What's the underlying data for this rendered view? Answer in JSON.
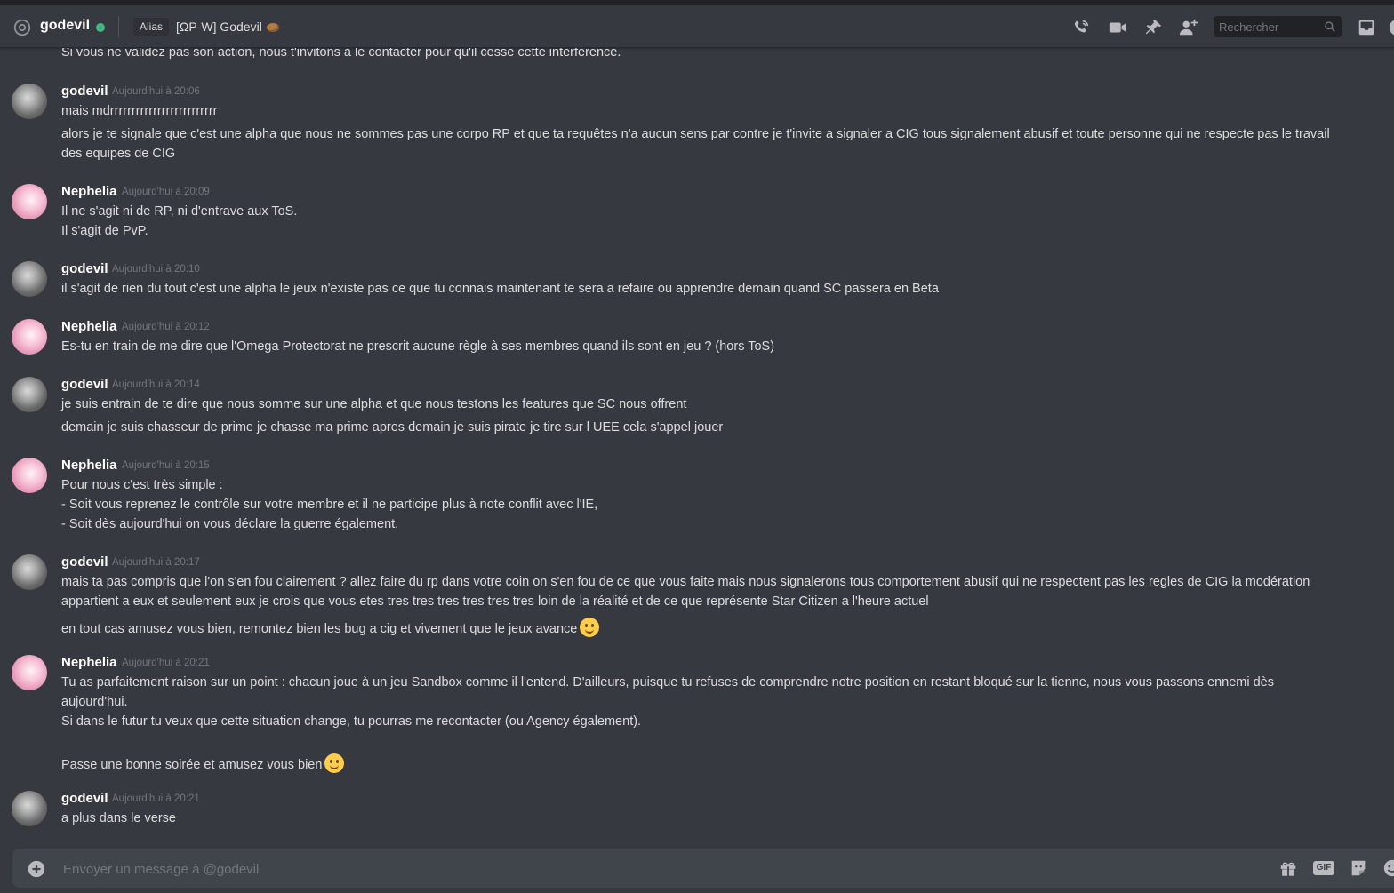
{
  "header": {
    "username": "godevil",
    "alias_label": "Alias",
    "alias_value": "[ΩP-W] Godevil",
    "search_placeholder": "Rechercher",
    "status_color": "#43b581"
  },
  "messages": [
    {
      "id": "m0",
      "lines": [
        "Si vous ne validez pas son action, nous t'invitons à le contacter pour qu'il cesse cette interférence."
      ]
    },
    {
      "id": "m1",
      "author": "godevil",
      "timestamp": "Aujourd'hui à 20:06",
      "lines": [
        "mais mdrrrrrrrrrrrrrrrrrrrrrrrrr",
        "alors je te signale que c'est une alpha que nous ne sommes pas une corpo RP et que ta requêtes n'a aucun sens par contre je t'invite a signaler a CIG tous signalement abusif et toute personne qui ne respecte pas le travail",
        "des equipes de CIG"
      ]
    },
    {
      "id": "m2",
      "author": "Nephelia",
      "timestamp": "Aujourd'hui à 20:09",
      "lines": [
        "Il ne s'agit ni de RP, ni d'entrave aux ToS.",
        "Il s'agit de PvP."
      ]
    },
    {
      "id": "m3",
      "author": "godevil",
      "timestamp": "Aujourd'hui à 20:10",
      "lines": [
        "il s'agit de rien du tout c'est une alpha le jeux n'existe pas ce que tu connais maintenant te sera a refaire ou apprendre demain quand SC passera en Beta"
      ]
    },
    {
      "id": "m4",
      "author": "Nephelia",
      "timestamp": "Aujourd'hui à 20:12",
      "lines": [
        "Es-tu en train de me dire que l'Omega Protectorat ne prescrit aucune règle à ses membres quand ils sont en jeu ? (hors ToS)"
      ]
    },
    {
      "id": "m5",
      "author": "godevil",
      "timestamp": "Aujourd'hui à 20:14",
      "lines": [
        "je suis entrain de te dire que nous somme sur une alpha et que nous testons les features que SC nous offrent",
        "demain je suis chasseur de prime je chasse ma prime apres demain je suis pirate je tire sur l UEE cela s'appel jouer"
      ]
    },
    {
      "id": "m6",
      "author": "Nephelia",
      "timestamp": "Aujourd'hui à 20:15",
      "lines": [
        "Pour nous c'est très simple :",
        "- Soit vous reprenez le contrôle sur votre membre et il ne participe plus à note conflit avec l'IE,",
        "- Soit dès aujourd'hui on vous déclare la guerre également."
      ]
    },
    {
      "id": "m7",
      "author": "godevil",
      "timestamp": "Aujourd'hui à 20:17",
      "lines": [
        "mais ta pas compris que l'on s'en fou clairement ? allez faire du rp dans votre coin on s'en fou de ce que vous faite mais nous signalerons tous comportement abusif qui ne respectent pas les regles de CIG la modération",
        "appartient a eux et seulement eux je crois que vous etes tres tres tres tres tres tres loin de la réalité et de ce que représente Star Citizen a l'heure actuel",
        "en tout cas amusez vous bien, remontez bien les bug a cig et vivement que le jeux avance"
      ]
    },
    {
      "id": "m8",
      "author": "Nephelia",
      "timestamp": "Aujourd'hui à 20:21",
      "lines": [
        "Tu as parfaitement raison sur un point : chacun joue à un jeu Sandbox comme il l'entend. D'ailleurs, puisque tu refuses de comprendre notre position en restant bloqué sur la tienne, nous vous passons ennemi dès",
        "aujourd'hui.",
        "Si dans le futur tu veux que cette situation change, tu pourras me recontacter (ou Agency également).",
        "Passe une bonne soirée et amusez vous bien"
      ]
    },
    {
      "id": "m9",
      "author": "godevil",
      "timestamp": "Aujourd'hui à 20:21",
      "lines": [
        "a plus dans le verse"
      ]
    }
  ],
  "composer": {
    "placeholder": "Envoyer un message à @godevil",
    "gif_label": "GIF"
  },
  "icons": {
    "header": [
      "at-icon",
      "phone-call-icon",
      "video-call-icon",
      "pin-icon",
      "add-friend-icon",
      "search-icon",
      "inbox-icon"
    ],
    "composer": [
      "plus-icon",
      "gift-icon",
      "gif-icon",
      "sticker-icon",
      "emoji-picker-icon"
    ],
    "inline_emoji": "slightly-smiling-face-emoji"
  }
}
